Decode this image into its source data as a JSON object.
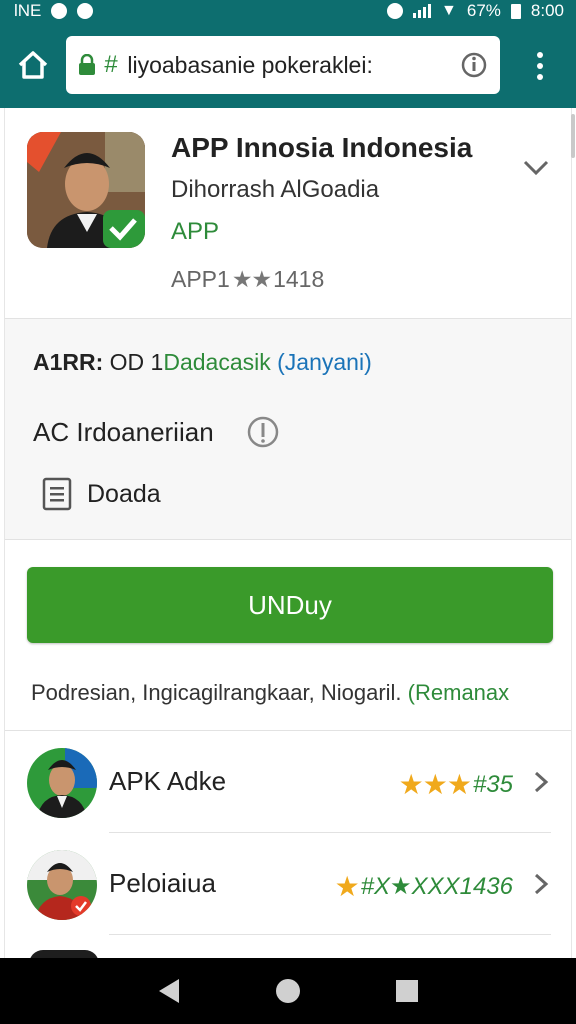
{
  "status_bar": {
    "left_text": "lNE",
    "battery": "67%",
    "time": "8:00"
  },
  "browser": {
    "url_hash": "#",
    "url": "liyoabasanie pokeraklei:"
  },
  "app": {
    "name": "APP Innosia Indonesia",
    "developer": "Dihorrash AlGoadia",
    "category": "APP",
    "rating_prefix": "APP1",
    "rating_stars": "★★",
    "rating_count": "1418"
  },
  "details": {
    "version_label": "A1RR:",
    "version_value": "OD 1",
    "status_green": "Dadacasik",
    "status_blue": "(Janyani)",
    "language": "AC Irdoaneriian",
    "content": "Doada"
  },
  "install": {
    "label": "UNDuy"
  },
  "permissions": {
    "text": "Podresian, Ingicagilrangkaar, Niogaril.",
    "link": "(Remanax"
  },
  "list": [
    {
      "name": "APK Adke",
      "stars": "★★★",
      "count": "#35"
    },
    {
      "name": "Peloiaiua",
      "stars": "★",
      "count": "#X★XXX1436"
    }
  ],
  "colors": {
    "toolbar": "#0d6e6f",
    "install_green": "#3a9a2a",
    "accent_green": "#2e8b3a",
    "star_orange": "#f0a91c"
  }
}
